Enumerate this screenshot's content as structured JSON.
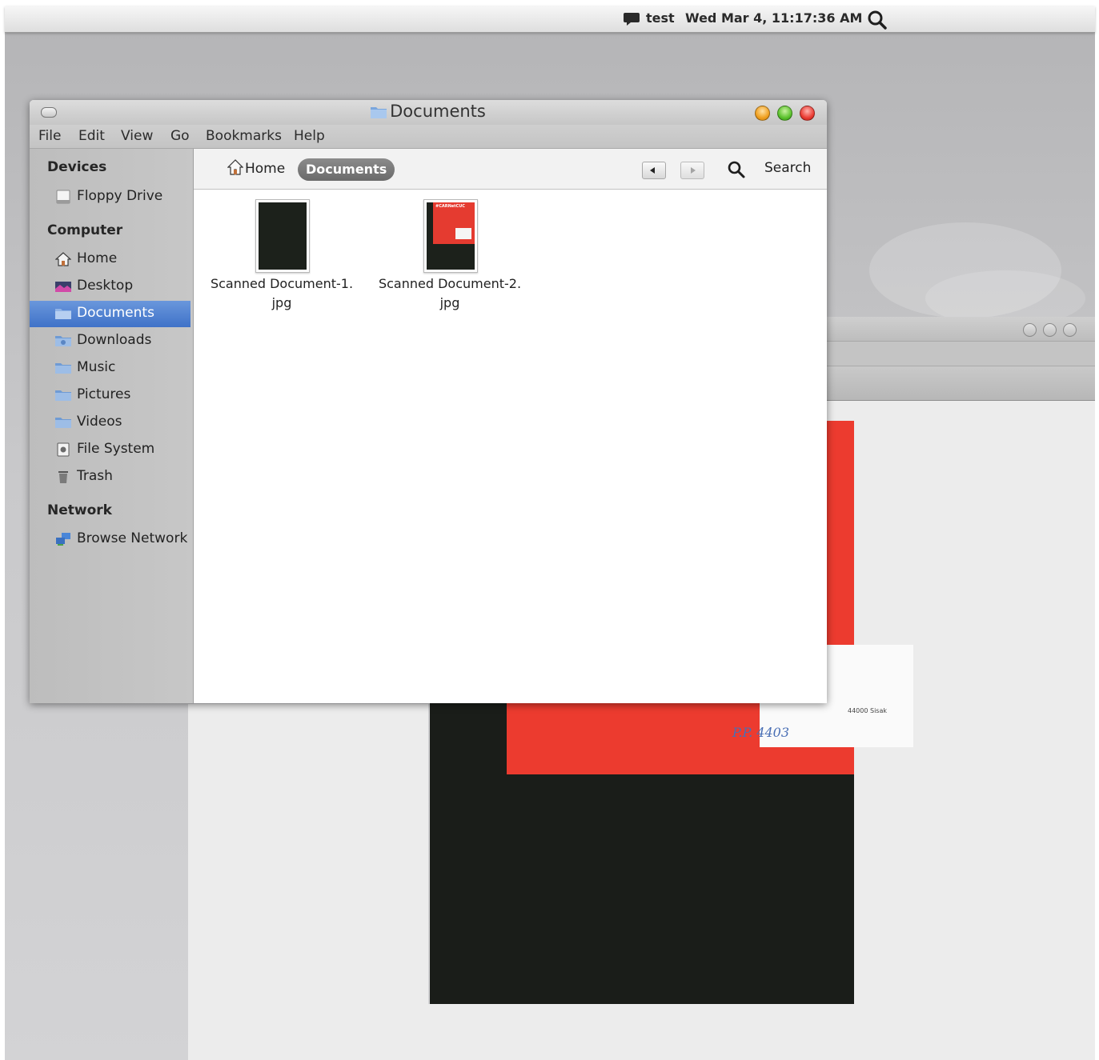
{
  "topbar": {
    "user": "test",
    "clock": "Wed Mar  4, 11:17:36 AM",
    "chat_icon": "chat-bubble-icon",
    "search_icon": "search-icon"
  },
  "window": {
    "title": "Documents",
    "menu": [
      "File",
      "Edit",
      "View",
      "Go",
      "Bookmarks",
      "Help"
    ]
  },
  "sidebar": {
    "sections": [
      {
        "heading": "Devices",
        "items": [
          {
            "label": "Floppy Drive",
            "icon": "floppy-drive-icon"
          }
        ]
      },
      {
        "heading": "Computer",
        "items": [
          {
            "label": "Home",
            "icon": "home-icon"
          },
          {
            "label": "Desktop",
            "icon": "desktop-icon"
          },
          {
            "label": "Documents",
            "icon": "folder-documents-icon",
            "selected": true
          },
          {
            "label": "Downloads",
            "icon": "folder-downloads-icon"
          },
          {
            "label": "Music",
            "icon": "folder-music-icon"
          },
          {
            "label": "Pictures",
            "icon": "folder-pictures-icon"
          },
          {
            "label": "Videos",
            "icon": "folder-videos-icon"
          },
          {
            "label": "File System",
            "icon": "file-system-icon"
          },
          {
            "label": "Trash",
            "icon": "trash-icon"
          }
        ]
      },
      {
        "heading": "Network",
        "items": [
          {
            "label": "Browse Network",
            "icon": "network-icon"
          }
        ]
      }
    ]
  },
  "toolbar": {
    "breadcrumb_home": "Home",
    "breadcrumb_current": "Documents",
    "search_label": "Search"
  },
  "files": [
    {
      "name_line1": "Scanned Document-1.",
      "name_line2": "jpg"
    },
    {
      "name_line1": "Scanned Document-2.",
      "name_line2": "jpg",
      "thumb_text": "#CARNetCUC"
    }
  ],
  "scan": {
    "address": "44000 Sisak",
    "handwriting": "P.P. 4403"
  },
  "colors": {
    "accent": "#3f72c8",
    "scan_red": "#ec3b2f",
    "scan_dark": "#1a1d19"
  }
}
